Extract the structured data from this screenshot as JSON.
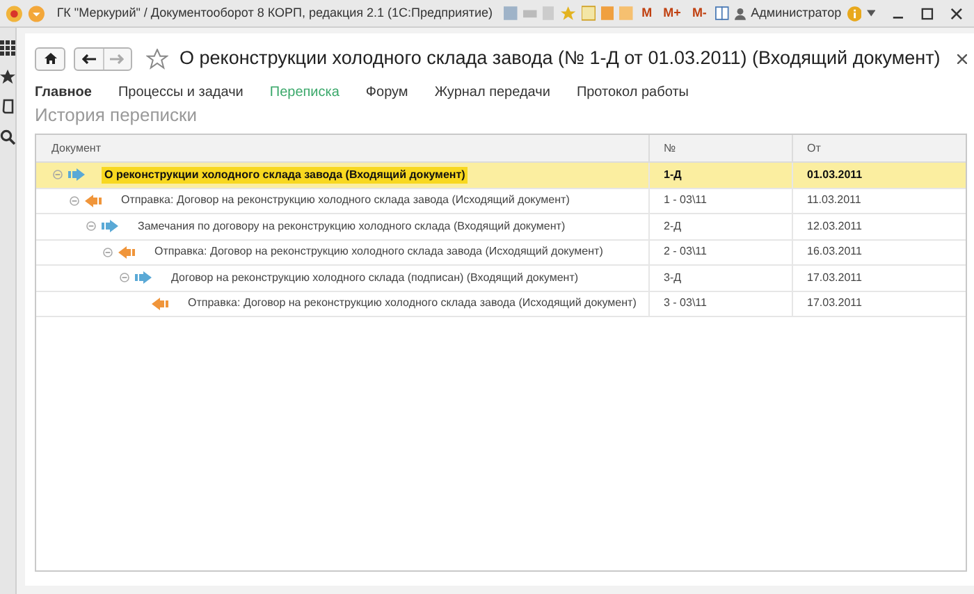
{
  "window": {
    "title": "ГК \"Меркурий\" / Документооборот 8 КОРП, редакция 2.1  (1С:Предприятие)",
    "toolbar_texts": [
      "M",
      "M+",
      "M-"
    ],
    "user": "Администратор"
  },
  "form": {
    "title": "О реконструкции холодного склада завода (№ 1-Д от 01.03.2011) (Входящий документ)",
    "favorite": false
  },
  "tabs": [
    {
      "label": "Главное",
      "kind": "main",
      "selected": false
    },
    {
      "label": "Процессы и задачи",
      "kind": "link",
      "selected": false
    },
    {
      "label": "Переписка",
      "kind": "link",
      "selected": true
    },
    {
      "label": "Форум",
      "kind": "link",
      "selected": false
    },
    {
      "label": "Журнал передачи",
      "kind": "link",
      "selected": false
    },
    {
      "label": "Протокол работы",
      "kind": "link",
      "selected": false
    }
  ],
  "section_title": "История переписки",
  "table": {
    "columns": [
      "Документ",
      "№",
      "От"
    ],
    "rows": [
      {
        "document": "О реконструкции холодного склада завода (Входящий документ)",
        "number": "1-Д",
        "date": "01.03.2011",
        "kind": "incoming",
        "selected": true,
        "expanded": true,
        "children": [
          {
            "document": "Отправка: Договор на реконструкцию холодного склада завода (Исходящий документ)",
            "number": "1 - 03\\11",
            "date": "11.03.2011",
            "kind": "outgoing",
            "selected": false,
            "expanded": true,
            "children": [
              {
                "document": "Замечания по договору на реконструкцию холодного склада  (Входящий документ)",
                "number": "2-Д",
                "date": "12.03.2011",
                "kind": "incoming",
                "selected": false,
                "expanded": true,
                "children": [
                  {
                    "document": "Отправка: Договор на реконструкцию холодного склада завода (Исходящий документ)",
                    "number": "2 - 03\\11",
                    "date": "16.03.2011",
                    "kind": "outgoing",
                    "selected": false,
                    "expanded": true,
                    "children": [
                      {
                        "document": "Договор на реконструкцию холодного склада (подписан) (Входящий документ)",
                        "number": "3-Д",
                        "date": "17.03.2011",
                        "kind": "incoming",
                        "selected": false,
                        "expanded": true,
                        "children": [
                          {
                            "document": "Отправка: Договор на реконструкцию холодного склада завода (Исходящий документ)",
                            "number": "3 - 03\\11",
                            "date": "17.03.2011",
                            "kind": "outgoing",
                            "selected": false
                          }
                        ]
                      }
                    ]
                  }
                ]
              }
            ]
          }
        ]
      }
    ]
  }
}
